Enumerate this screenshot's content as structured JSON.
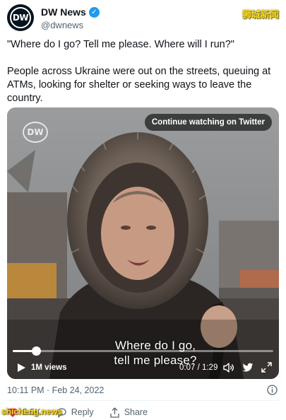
{
  "account": {
    "display_name": "DW News",
    "handle": "@dwnews",
    "avatar_text": "DW",
    "verified_glyph": "✓"
  },
  "watermarks": {
    "top": "狮城新闻",
    "bottom": "shicheng.news"
  },
  "tweet": {
    "quote": "\"Where do I go? Tell me please. Where will I run?\"",
    "body": "People across Ukraine were out on the streets, queuing at ATMs, looking for shelter or seeking ways to leave the country."
  },
  "video": {
    "channel_logo": "DW",
    "continue_label": "Continue watching on Twitter",
    "subtitle_line1": "Where do I go,",
    "subtitle_line2": "tell me please?",
    "views": "1M views",
    "time": "0:07 / 1:29",
    "progress_fraction": 0.09
  },
  "meta": {
    "timestamp": "10:11 PM · Feb 24, 2022"
  },
  "actions": {
    "like_count": "5.5K",
    "reply_label": "Reply",
    "share_label": "Share"
  },
  "colors": {
    "verified": "#1d9bf0",
    "secondary_text": "#536471",
    "like_red": "#f91880",
    "watermark": "#f4d92a"
  },
  "icons": [
    "verified-icon",
    "play-icon",
    "volume-icon",
    "twitter-icon",
    "fullscreen-icon",
    "info-icon",
    "heart-icon",
    "reply-icon",
    "share-icon"
  ]
}
